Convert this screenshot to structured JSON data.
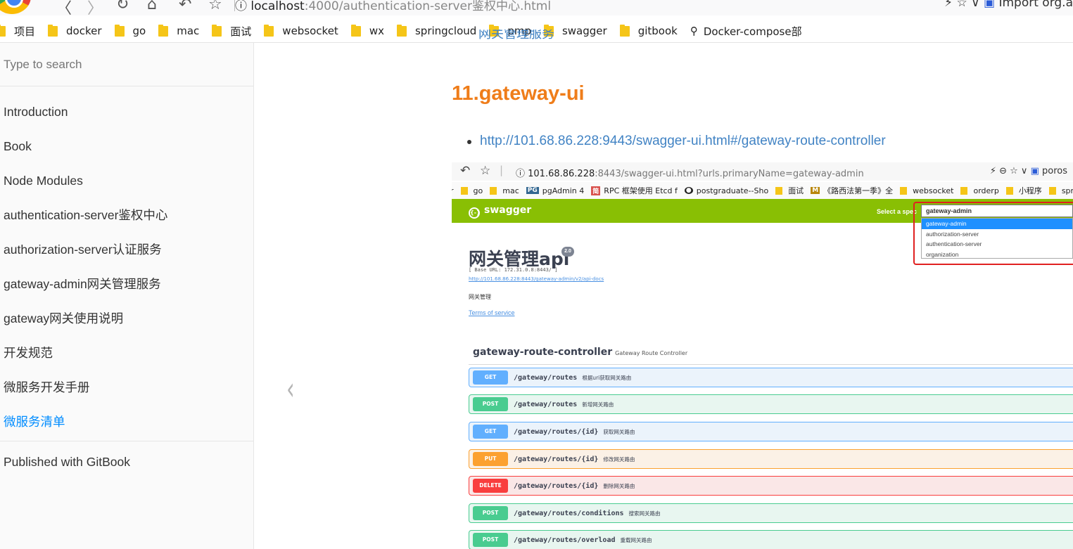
{
  "browser": {
    "url_host": "localhost",
    "url_rest": ":4000/authentication-server鉴权中心.html",
    "right_text": "Import org.a",
    "nav_icons": [
      "back-icon",
      "forward-icon",
      "reload-icon",
      "home-icon",
      "undo-icon",
      "star-icon"
    ]
  },
  "bookmarks": [
    "项目",
    "docker",
    "go",
    "mac",
    "面试",
    "websocket",
    "wx",
    "springcloud",
    "pmp",
    "swagger",
    "gitbook",
    "Docker-compose部"
  ],
  "sidebar": {
    "search_placeholder": "Type to search",
    "items": [
      {
        "label": "Introduction"
      },
      {
        "label": "Book"
      },
      {
        "label": "Node Modules"
      },
      {
        "label": "authentication-server鉴权中心"
      },
      {
        "label": "authorization-server认证服务"
      },
      {
        "label": "gateway-admin网关管理服务"
      },
      {
        "label": "gateway网关使用说明"
      },
      {
        "label": "开发规范"
      },
      {
        "label": "微服务开发手册"
      },
      {
        "label": "微服务清单"
      }
    ],
    "published": "Published with GitBook"
  },
  "content": {
    "cut_text": "网关管理服务",
    "heading": "11.gateway-ui",
    "link": "http://101.68.86.228:9443/swagger-ui.html#/gateway-route-controller"
  },
  "embed": {
    "url_main": "101.68.86.228",
    "url_rest": ":8443/swagger-ui.html?urls.primaryName=gateway-admin",
    "right": "poros",
    "bookmarks": [
      "r",
      "go",
      "mac",
      "pgAdmin 4",
      "RPC 框架使用 Etcd f",
      "postgraduate--Sho",
      "面试",
      "《路西法第一季》全",
      "websocket",
      "orderp",
      "小程序",
      "sprin"
    ],
    "swagger_logo": "swagger",
    "select_label": "Select a spec",
    "select_value": "gateway-admin",
    "options": [
      "gateway-admin",
      "authorization-server",
      "authentication-server",
      "organization"
    ],
    "api_title": "网关管理api",
    "version": "2.0",
    "base_url": "[ Base URL: 172.31.0.8:8443/ ]",
    "docs_link": "http://101.68.86.228:8443/gateway-admin/v2/api-docs",
    "description": "网关管理",
    "terms": "Terms of service",
    "controller": "gateway-route-controller",
    "controller_desc": "Gateway Route Controller",
    "operations": [
      {
        "method": "GET",
        "path": "/gateway/routes",
        "summary": "根据uri获取网关路由"
      },
      {
        "method": "POST",
        "path": "/gateway/routes",
        "summary": "新增网关路由"
      },
      {
        "method": "GET",
        "path": "/gateway/routes/{id}",
        "summary": "获取网关路由"
      },
      {
        "method": "PUT",
        "path": "/gateway/routes/{id}",
        "summary": "修改网关路由"
      },
      {
        "method": "DELETE",
        "path": "/gateway/routes/{id}",
        "summary": "删除网关路由"
      },
      {
        "method": "POST",
        "path": "/gateway/routes/conditions",
        "summary": "搜索网关路由"
      },
      {
        "method": "POST",
        "path": "/gateway/routes/overload",
        "summary": "重载网关路由"
      }
    ]
  },
  "colors": {
    "heading": "#ef7d1a",
    "link": "#4183c4",
    "active": "#008cff",
    "swagger_green": "#89bf04"
  }
}
